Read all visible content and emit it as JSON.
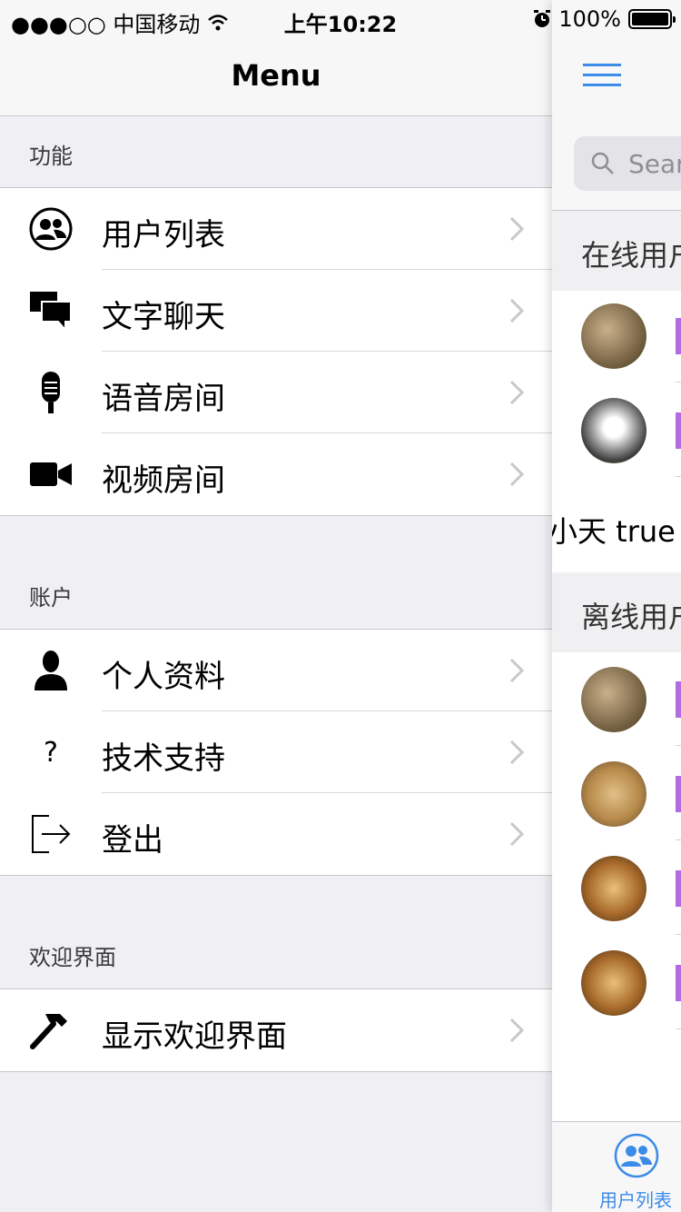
{
  "status_bar": {
    "carrier": "●●●○○ 中国移动",
    "time": "上午10:22",
    "battery": "100%"
  },
  "menu": {
    "title": "Menu",
    "sections": [
      {
        "header": "功能",
        "items": [
          "用户列表",
          "文字聊天",
          "语音房间",
          "视频房间"
        ]
      },
      {
        "header": "账户",
        "items": [
          "个人资料",
          "技术支持",
          "登出"
        ]
      },
      {
        "header": "欢迎界面",
        "items": [
          "显示欢迎界面"
        ]
      }
    ]
  },
  "content": {
    "search_placeholder": "Sear",
    "online_header": "在线用户",
    "offline_header": "离线用户",
    "loose_text": "小天 true",
    "tab_label": "用户列表"
  },
  "colors": {
    "accent": "#3b8be8",
    "tag": "#b36ce0"
  }
}
